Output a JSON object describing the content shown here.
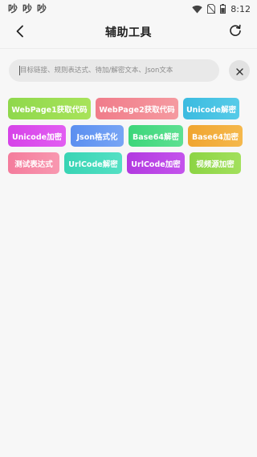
{
  "status_bar": {
    "notif_icons": [
      "notification-icon",
      "notification-icon",
      "notification-icon"
    ],
    "time": "8:12"
  },
  "appbar": {
    "title": "辅助工具"
  },
  "search": {
    "placeholder": "目标链接、规则表达式、待加/解密文本、Json文本",
    "value": ""
  },
  "tools": [
    [
      {
        "label": "WebPage1获取代码",
        "color_from": "#8fd84c",
        "color_to": "#a8e35a"
      },
      {
        "label": "WebPage2获取代码",
        "color_from": "#f07c8a",
        "color_to": "#f59aa0"
      },
      {
        "label": "Unicode解密",
        "color_from": "#3bbbe0",
        "color_to": "#56cbe8"
      }
    ],
    [
      {
        "label": "Unicode加密",
        "color_from": "#d643e8",
        "color_to": "#e25ef2"
      },
      {
        "label": "Json格式化",
        "color_from": "#5b8ff0",
        "color_to": "#78a5f5"
      },
      {
        "label": "Base64解密",
        "color_from": "#3dd67a",
        "color_to": "#5ee092"
      },
      {
        "label": "Base64加密",
        "color_from": "#f0a530",
        "color_to": "#f5b84c"
      }
    ],
    [
      {
        "label": "测试表达式",
        "color_from": "#f47c9c",
        "color_to": "#f898b0"
      },
      {
        "label": "UrlCode解密",
        "color_from": "#38d4b4",
        "color_to": "#54e0c4"
      },
      {
        "label": "UrlCode加密",
        "color_from": "#b23ae0",
        "color_to": "#c454ec"
      },
      {
        "label": "视频源加密",
        "color_from": "#8cd444",
        "color_to": "#a2e05c"
      }
    ]
  ]
}
